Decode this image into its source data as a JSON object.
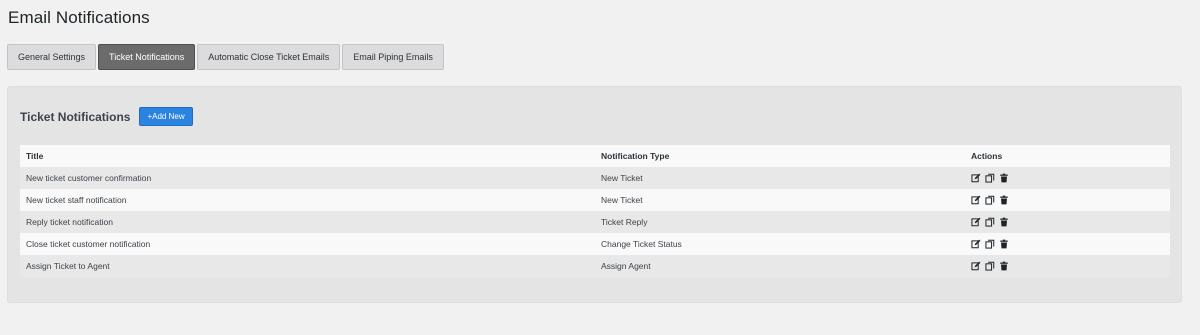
{
  "page": {
    "title": "Email Notifications"
  },
  "tabs": [
    {
      "label": "General Settings",
      "active": false
    },
    {
      "label": "Ticket Notifications",
      "active": true
    },
    {
      "label": "Automatic Close Ticket Emails",
      "active": false
    },
    {
      "label": "Email Piping Emails",
      "active": false
    }
  ],
  "panel": {
    "title": "Ticket Notifications",
    "add_button": "+Add New"
  },
  "table": {
    "headers": [
      "Title",
      "Notification Type",
      "Actions"
    ],
    "rows": [
      {
        "title": "New ticket customer confirmation",
        "type": "New Ticket"
      },
      {
        "title": "New ticket staff notification",
        "type": "New Ticket"
      },
      {
        "title": "Reply ticket notification",
        "type": "Ticket Reply"
      },
      {
        "title": "Close ticket customer notification",
        "type": "Change Ticket Status"
      },
      {
        "title": "Assign Ticket to Agent",
        "type": "Assign Agent"
      }
    ],
    "row_actions": [
      "edit-icon",
      "duplicate-icon",
      "trash-icon"
    ]
  },
  "colors": {
    "accent": "#2a83e0",
    "active_tab": "#6b6b6b"
  }
}
